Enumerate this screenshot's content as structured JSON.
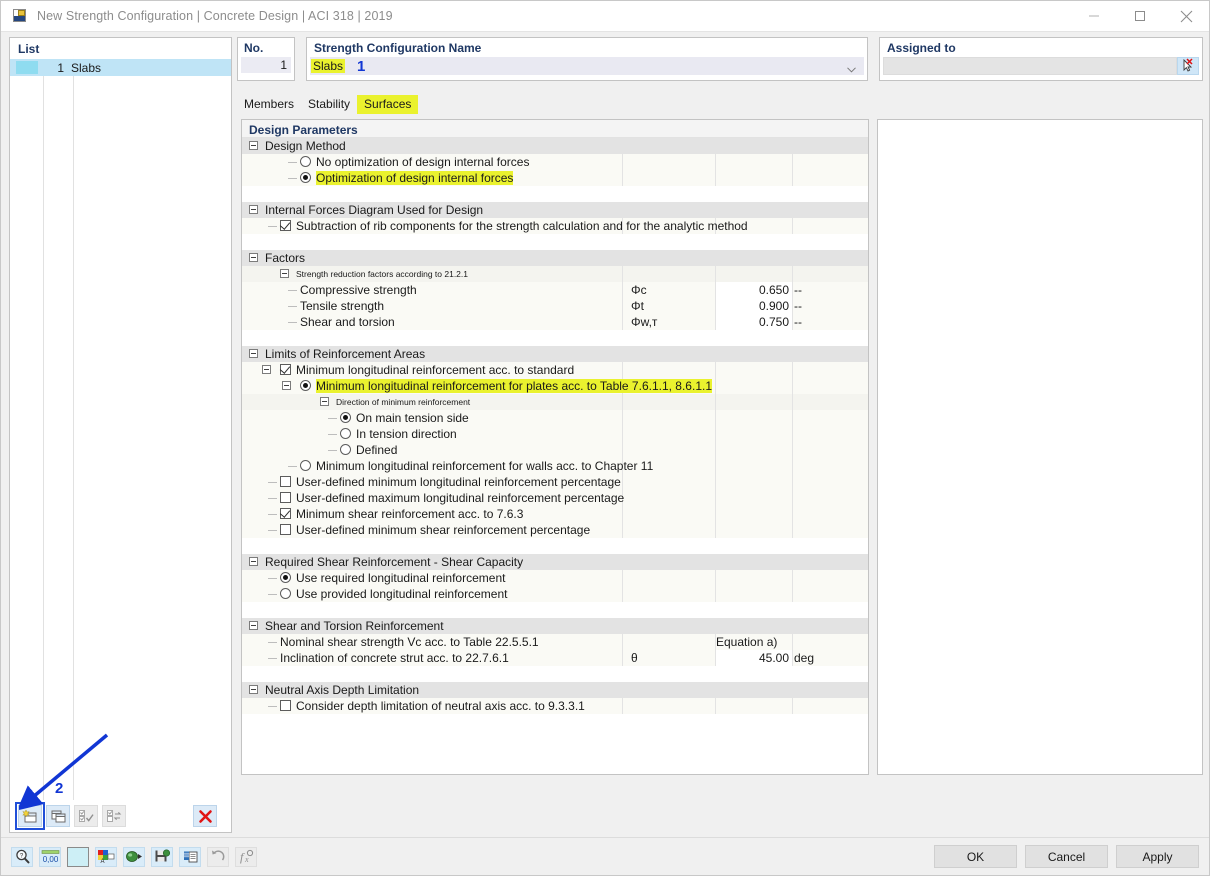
{
  "window": {
    "title": "New Strength Configuration | Concrete Design | ACI 318 | 2019",
    "icon": "app-icon",
    "minimize": "–",
    "maximize": "□",
    "close": "✕"
  },
  "list": {
    "header": "List",
    "rows": [
      {
        "no": "1",
        "name": "Slabs",
        "color": "#8fdcf0"
      }
    ],
    "toolbar": [
      {
        "name": "new-configuration-button",
        "label": "New",
        "selected": true
      },
      {
        "name": "copy-configuration-button",
        "label": "Copy",
        "selected": false
      },
      {
        "name": "select-all-button",
        "label": "Select All",
        "disabled": true
      },
      {
        "name": "invert-selection-button",
        "label": "Invert Selection",
        "disabled": true
      },
      {
        "name": "delete-configuration-button",
        "label": "Delete",
        "selected": false
      }
    ]
  },
  "annotations": [
    {
      "id": "1",
      "label": "1",
      "target": "strength-configuration-name-combobox"
    },
    {
      "id": "2",
      "label": "2",
      "target": "new-configuration-button"
    }
  ],
  "no_panel": {
    "header": "No.",
    "value": "1"
  },
  "name_panel": {
    "header": "Strength Configuration Name",
    "value": "Slabs",
    "annotation": "1",
    "chevron": "chevron-down-icon"
  },
  "assigned_panel": {
    "header": "Assigned to",
    "value": "",
    "placeholder": "",
    "pick_button": "select-objects-button"
  },
  "tabs": [
    {
      "label": "Members",
      "active": false
    },
    {
      "label": "Stability",
      "active": false
    },
    {
      "label": "Surfaces",
      "active": true
    }
  ],
  "tree": {
    "header": "Design Parameters",
    "sections": [
      {
        "title": "Design Method",
        "items": [
          {
            "type": "radio",
            "label": "No optimization of design internal forces",
            "checked": false,
            "highlight": false,
            "indent": 2
          },
          {
            "type": "radio",
            "label": "Optimization of design internal forces",
            "checked": true,
            "highlight": true,
            "indent": 2
          }
        ]
      },
      {
        "title": "Internal Forces Diagram Used for Design",
        "items": [
          {
            "type": "checkbox",
            "label": "Subtraction of rib components for the strength calculation and for the analytic method",
            "checked": true,
            "highlight": false,
            "indent": 1
          }
        ]
      },
      {
        "title": "Factors",
        "items": [
          {
            "type": "subgroup",
            "label": "Strength reduction factors according to 21.2.1",
            "indent": 1
          },
          {
            "type": "value",
            "label": "Compressive strength",
            "symbol": "Φc",
            "value": "0.650",
            "unit": "--",
            "indent": 2
          },
          {
            "type": "value",
            "label": "Tensile strength",
            "symbol": "Φt",
            "value": "0.900",
            "unit": "--",
            "indent": 2
          },
          {
            "type": "value",
            "label": "Shear and torsion",
            "symbol": "Φw,т",
            "value": "0.750",
            "unit": "--",
            "indent": 2
          }
        ]
      },
      {
        "title": "Limits of Reinforcement Areas",
        "items": [
          {
            "type": "checkbox-group",
            "label": "Minimum longitudinal reinforcement acc. to standard",
            "checked": true,
            "highlight": false,
            "indent": 1
          },
          {
            "type": "radio-group",
            "label": "Minimum longitudinal reinforcement for plates acc. to Table 7.6.1.1, 8.6.1.1",
            "checked": true,
            "highlight": true,
            "indent": 2
          },
          {
            "type": "subgroup",
            "label": "Direction of minimum reinforcement",
            "indent": 3
          },
          {
            "type": "radio",
            "label": "On main tension side",
            "checked": true,
            "highlight": false,
            "indent": 4
          },
          {
            "type": "radio",
            "label": "In tension direction",
            "checked": false,
            "highlight": false,
            "indent": 4
          },
          {
            "type": "radio",
            "label": "Defined",
            "checked": false,
            "highlight": false,
            "indent": 4
          },
          {
            "type": "radio",
            "label": "Minimum longitudinal reinforcement for walls acc. to Chapter 11",
            "checked": false,
            "highlight": false,
            "indent": 2
          },
          {
            "type": "checkbox",
            "label": "User-defined minimum longitudinal reinforcement percentage",
            "checked": false,
            "highlight": false,
            "indent": 1
          },
          {
            "type": "checkbox",
            "label": "User-defined maximum longitudinal reinforcement percentage",
            "checked": false,
            "highlight": false,
            "indent": 1
          },
          {
            "type": "checkbox",
            "label": "Minimum shear reinforcement acc. to 7.6.3",
            "checked": true,
            "highlight": false,
            "indent": 1
          },
          {
            "type": "checkbox",
            "label": "User-defined minimum shear reinforcement percentage",
            "checked": false,
            "highlight": false,
            "indent": 1
          }
        ]
      },
      {
        "title": "Required Shear Reinforcement - Shear Capacity",
        "items": [
          {
            "type": "radio",
            "label": "Use required longitudinal reinforcement",
            "checked": true,
            "highlight": false,
            "indent": 1
          },
          {
            "type": "radio",
            "label": "Use provided longitudinal reinforcement",
            "checked": false,
            "highlight": false,
            "indent": 1
          }
        ]
      },
      {
        "title": "Shear and Torsion Reinforcement",
        "items": [
          {
            "type": "text-value",
            "label": "Nominal shear strength Vc acc. to Table 22.5.5.1",
            "symbol": "",
            "value": "Equation a)",
            "unit": "",
            "indent": 1
          },
          {
            "type": "value",
            "label": "Inclination of concrete strut acc. to 22.7.6.1",
            "symbol": "θ",
            "value": "45.00",
            "unit": "deg",
            "indent": 1
          }
        ]
      },
      {
        "title": "Neutral Axis Depth Limitation",
        "items": [
          {
            "type": "checkbox",
            "label": "Consider depth limitation of neutral axis acc. to 9.3.3.1",
            "checked": false,
            "highlight": false,
            "indent": 1
          }
        ]
      }
    ]
  },
  "statusbar": {
    "icons": [
      {
        "name": "help-magnifier-icon",
        "label": "Help",
        "disabled": false
      },
      {
        "name": "number-format-icon",
        "label": "0,00",
        "disabled": false
      },
      {
        "name": "color-swatch-icon",
        "label": "Color",
        "disabled": false
      },
      {
        "name": "font-color-icon",
        "label": "Display Properties",
        "disabled": false
      },
      {
        "name": "render-icon",
        "label": "Rendering",
        "disabled": false
      },
      {
        "name": "save-settings-icon",
        "label": "Save",
        "disabled": false
      },
      {
        "name": "copy-layers-icon",
        "label": "Copy",
        "disabled": false
      },
      {
        "name": "undo-icon",
        "label": "Undo",
        "disabled": true
      },
      {
        "name": "formula-icon",
        "label": "f(x)",
        "disabled": true
      }
    ]
  },
  "dialog_buttons": [
    {
      "label": "OK",
      "name": "ok-button"
    },
    {
      "label": "Cancel",
      "name": "cancel-button"
    },
    {
      "label": "Apply",
      "name": "apply-button"
    }
  ]
}
